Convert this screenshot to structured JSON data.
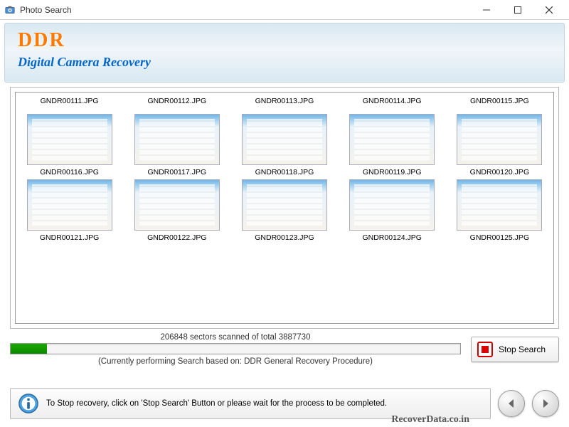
{
  "window": {
    "title": "Photo Search"
  },
  "banner": {
    "brand": "DDR",
    "subtitle": "Digital Camera Recovery"
  },
  "gallery": {
    "row1_labels": [
      "GNDR00111.JPG",
      "GNDR00112.JPG",
      "GNDR00113.JPG",
      "GNDR00114.JPG",
      "GNDR00115.JPG"
    ],
    "row2": [
      {
        "filename": "GNDR00116.JPG"
      },
      {
        "filename": "GNDR00117.JPG"
      },
      {
        "filename": "GNDR00118.JPG"
      },
      {
        "filename": "GNDR00119.JPG"
      },
      {
        "filename": "GNDR00120.JPG"
      }
    ],
    "row3": [
      {
        "filename": "GNDR00121.JPG"
      },
      {
        "filename": "GNDR00122.JPG"
      },
      {
        "filename": "GNDR00123.JPG"
      },
      {
        "filename": "GNDR00124.JPG"
      },
      {
        "filename": "GNDR00125.JPG"
      }
    ]
  },
  "progress": {
    "status": "206848 sectors scanned of total 3887730",
    "note": "(Currently performing Search based on:  DDR General Recovery Procedure)",
    "stop_label": "Stop Search"
  },
  "footer": {
    "tip": "To Stop recovery, click on 'Stop Search' Button or please wait for the process to be completed."
  },
  "watermark": "RecoverData.co.in"
}
